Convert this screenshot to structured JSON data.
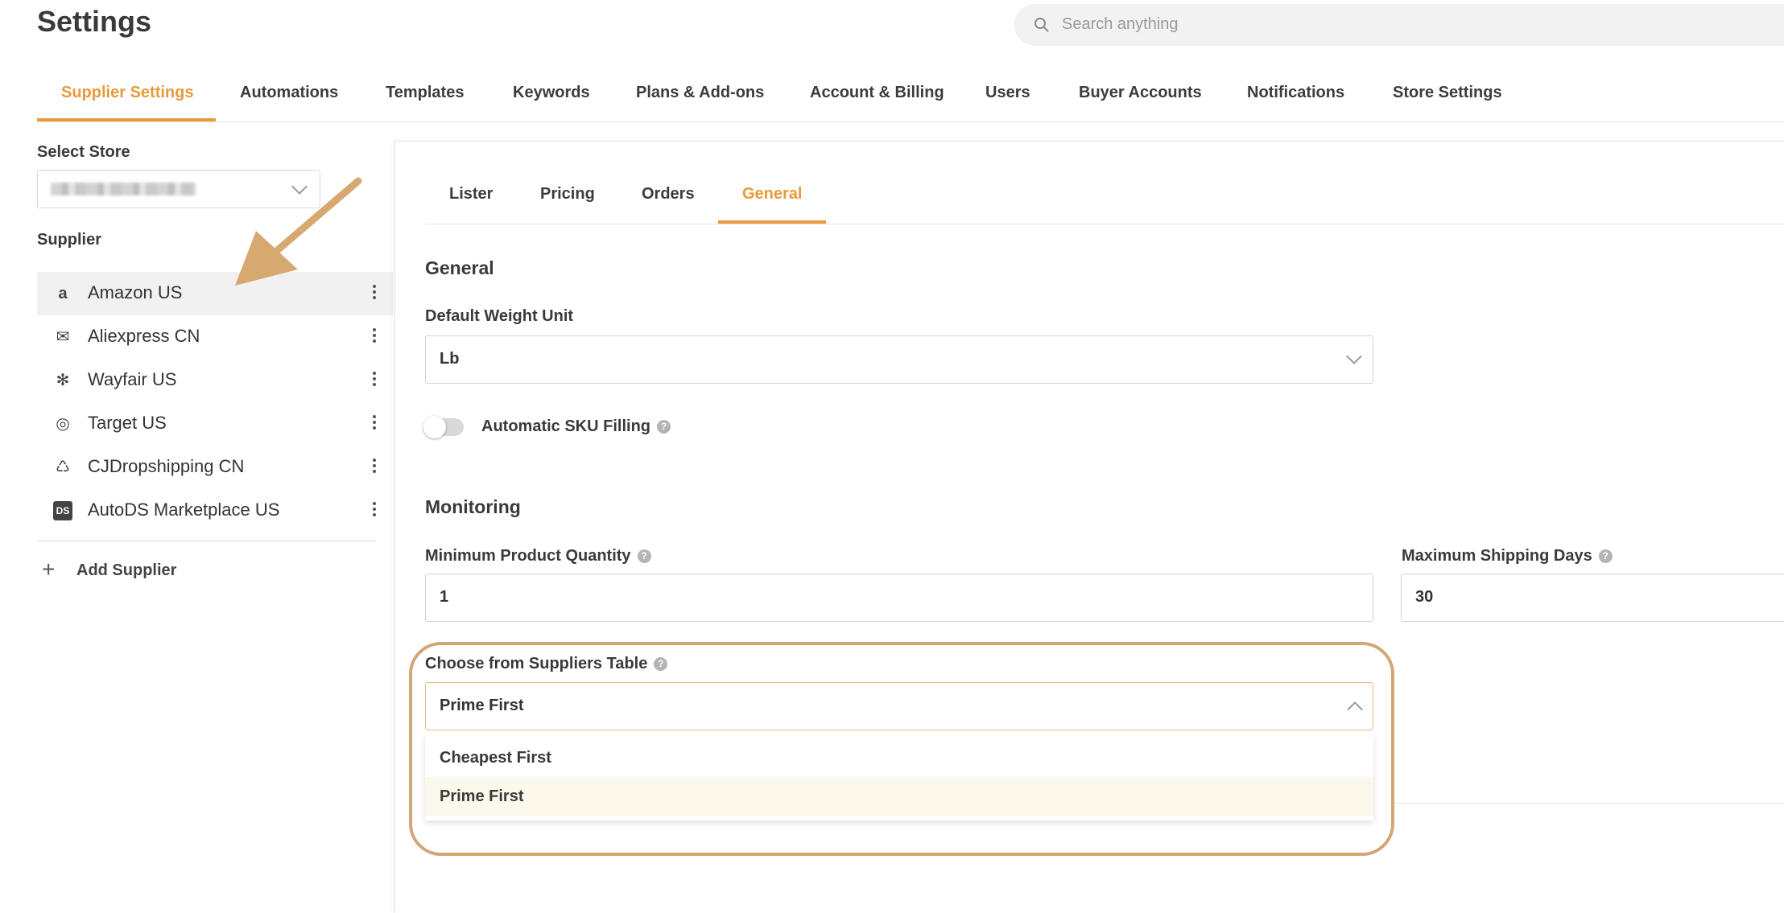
{
  "header": {
    "title": "Settings",
    "search_placeholder": "Search anything"
  },
  "main_tabs": [
    {
      "label": "Supplier Settings",
      "active": true
    },
    {
      "label": "Automations"
    },
    {
      "label": "Templates"
    },
    {
      "label": "Keywords"
    },
    {
      "label": "Plans & Add-ons"
    },
    {
      "label": "Account & Billing"
    },
    {
      "label": "Users"
    },
    {
      "label": "Buyer Accounts"
    },
    {
      "label": "Notifications"
    },
    {
      "label": "Store Settings"
    }
  ],
  "sidebar": {
    "select_store_label": "Select Store",
    "supplier_heading": "Supplier",
    "suppliers": [
      {
        "name": "Amazon US",
        "icon": "amazon-icon",
        "glyph": "a",
        "active": true
      },
      {
        "name": "Aliexpress CN",
        "icon": "aliexpress-icon",
        "glyph": "✉"
      },
      {
        "name": "Wayfair US",
        "icon": "wayfair-icon",
        "glyph": "✻"
      },
      {
        "name": "Target US",
        "icon": "target-icon",
        "glyph": "◎"
      },
      {
        "name": "CJDropshipping CN",
        "icon": "cjdropshipping-icon",
        "glyph": "♺"
      },
      {
        "name": "AutoDS Marketplace US",
        "icon": "autods-icon",
        "glyph": "DS"
      }
    ],
    "add_supplier_label": "Add Supplier"
  },
  "sub_tabs": [
    {
      "label": "Lister"
    },
    {
      "label": "Pricing"
    },
    {
      "label": "Orders"
    },
    {
      "label": "General",
      "active": true
    }
  ],
  "general": {
    "heading": "General",
    "weight_unit_label": "Default Weight Unit",
    "weight_unit_value": "Lb",
    "auto_sku_label": "Automatic SKU Filling",
    "auto_sku_enabled": false
  },
  "monitoring": {
    "heading": "Monitoring",
    "min_qty_label": "Minimum Product Quantity",
    "min_qty_value": "1",
    "max_shipping_label": "Maximum Shipping Days",
    "max_shipping_value": "30",
    "suppliers_table_label": "Choose from Suppliers Table",
    "suppliers_table_value": "Prime First",
    "suppliers_table_options": [
      "Cheapest First",
      "Prime First"
    ]
  },
  "colors": {
    "accent": "#e89a3c",
    "annotation": "#d4a673"
  }
}
